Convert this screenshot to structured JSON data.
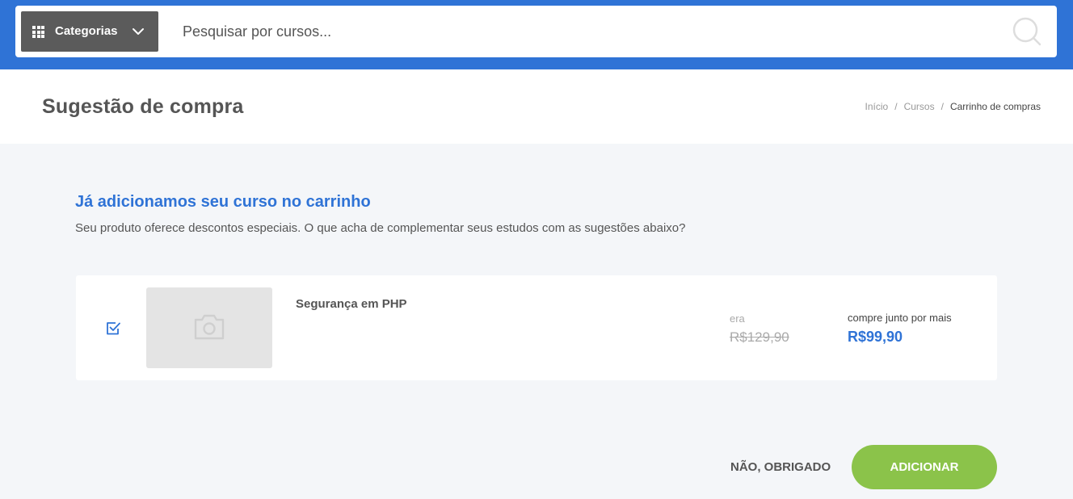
{
  "topbar": {
    "categories_label": "Categorias",
    "search_placeholder": "Pesquisar por cursos..."
  },
  "header": {
    "title": "Sugestão de compra",
    "breadcrumb": {
      "home": "Início",
      "courses": "Cursos",
      "current": "Carrinho de compras",
      "separator": "/"
    }
  },
  "intro": {
    "title": "Já adicionamos seu curso no carrinho",
    "text": "Seu produto oferece descontos especiais. O que acha de complementar seus estudos com as sugestões abaixo?"
  },
  "suggestion": {
    "checked": true,
    "name": "Segurança em PHP",
    "was_label": "era",
    "was_price": "R$129,90",
    "now_label": "compre junto por mais",
    "now_price": "R$99,90"
  },
  "actions": {
    "no_thanks": "NÃO, OBRIGADO",
    "add": "ADICIONAR"
  },
  "colors": {
    "brand_blue": "#2f73d6",
    "add_green": "#8bc34a",
    "dark_button": "#5b5b5b"
  }
}
